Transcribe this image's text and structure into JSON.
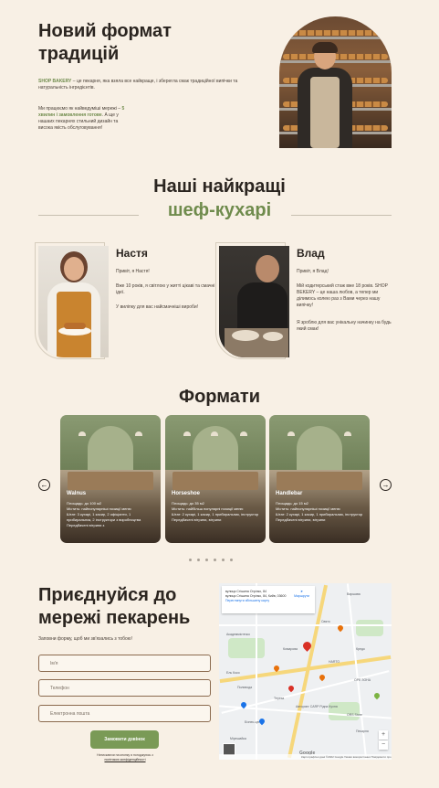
{
  "hero": {
    "title": "Новий формат традицій",
    "p1_brand": "SHOP BAKERY",
    "p1_text": " – це пекарня, яка взяла все найкраще, і зберегла смак традиційної випічки та натуральність інгредієнтів.",
    "p2_start": "Ми працюємо як найведуміші мережі – ",
    "p2_accent": "5 хвилин і замовлення готове",
    "p2_end": ". А ще у нашаих пекарнях стильний дизайн та висока якість обслуговування!"
  },
  "chefs": {
    "title": "Наші найкращі",
    "subtitle": "шеф-кухарі",
    "items": [
      {
        "name": "Настя",
        "p1": "Привіт, я Настя!",
        "p2": "Вже 10 років, я світлою у житті цікаві та смачні ідеї.",
        "p3": "У виліпку для вас найсмачніші вироби!"
      },
      {
        "name": "Влад",
        "p1": "Привіт, я Влад!",
        "p2": "Мій кодитерський стаж вже 18 років. SHOP BEKERY – це наша любов, а тепер ми ділимось колею раз з Вами через нашу випічку!",
        "p3": "Я зроблю для вас унікальну начинку на будь який смак!"
      }
    ]
  },
  "formats": {
    "title": "Формати",
    "prev_label": "←",
    "next_label": "→",
    "cards": [
      {
        "name": "Walnus",
        "lines": [
          "Площадь: до 100 м2",
          "Містить: найпопулярніші позиції меню",
          "Штат: 3 кухарі, 1 касир, 2 офіціанти, 1 прибиральник, 2 інструктори з виробництва",
          "Передбачені вітрини з"
        ]
      },
      {
        "name": "Horseshoe",
        "lines": [
          "Площадь: до 35 м2",
          "Містить: найбільш популярні позиції меню",
          "Штат: 2 кухарі, 1 касир, 1 прибиральник, інструктор",
          "Передбачені вітрини, вітрини"
        ]
      },
      {
        "name": "Handlebar",
        "lines": [
          "Площадь: до 15 м2",
          "Містить: найпопулярніші позиції меню",
          "Штат: 2 кухарі, 1 касир, 1 прибиральник, інструктор",
          "Передбачені вітрини, вітрини"
        ]
      }
    ]
  },
  "join": {
    "title": "Приєднуйся до мережі пекарень",
    "subtitle": "Заповни форму, щоб ми зв'язались з тобою!",
    "name_placeholder": "Ім'я",
    "phone_placeholder": "Телефон",
    "email_placeholder": "Електронна пошта",
    "submit_label": "Замовити дзвінок",
    "consent_text": "Натискаючи на кнопку я погоджуюсь з",
    "consent_link": "політикою конфіденційності"
  },
  "map": {
    "card_line1": "вулиця Стішина Огрілко, 84",
    "card_line2": "вулиця Стішина Огрілко, 84, Кийв, 03600",
    "card_link": "Переглянути збільшену карту",
    "directions": "Маршрути",
    "labels": [
      "Свято",
      "Академмістечко",
      "Варшава",
      "Комарова",
      "HARTO",
      "Авторинг CARP Рідна Кухня",
      "Кредо",
      "Поливода",
      "Бізнес-центр",
      "ОРЕ ЗОНА",
      "Пекарня",
      "Ель Коко",
      "Тереза",
      "Мірешайка",
      "ORS Store"
    ],
    "google": "Google",
    "footer": "Картографічні дані ©2022 Google  Умови використання  Повідомити про помилку на карті",
    "zoom_in": "+",
    "zoom_out": "−",
    "accent": "#1a73e8",
    "pin_color": "#d93025"
  },
  "colors": {
    "accent_green": "#6f8b4c",
    "button_green": "#7a9a56",
    "background": "#f8f0e5"
  }
}
